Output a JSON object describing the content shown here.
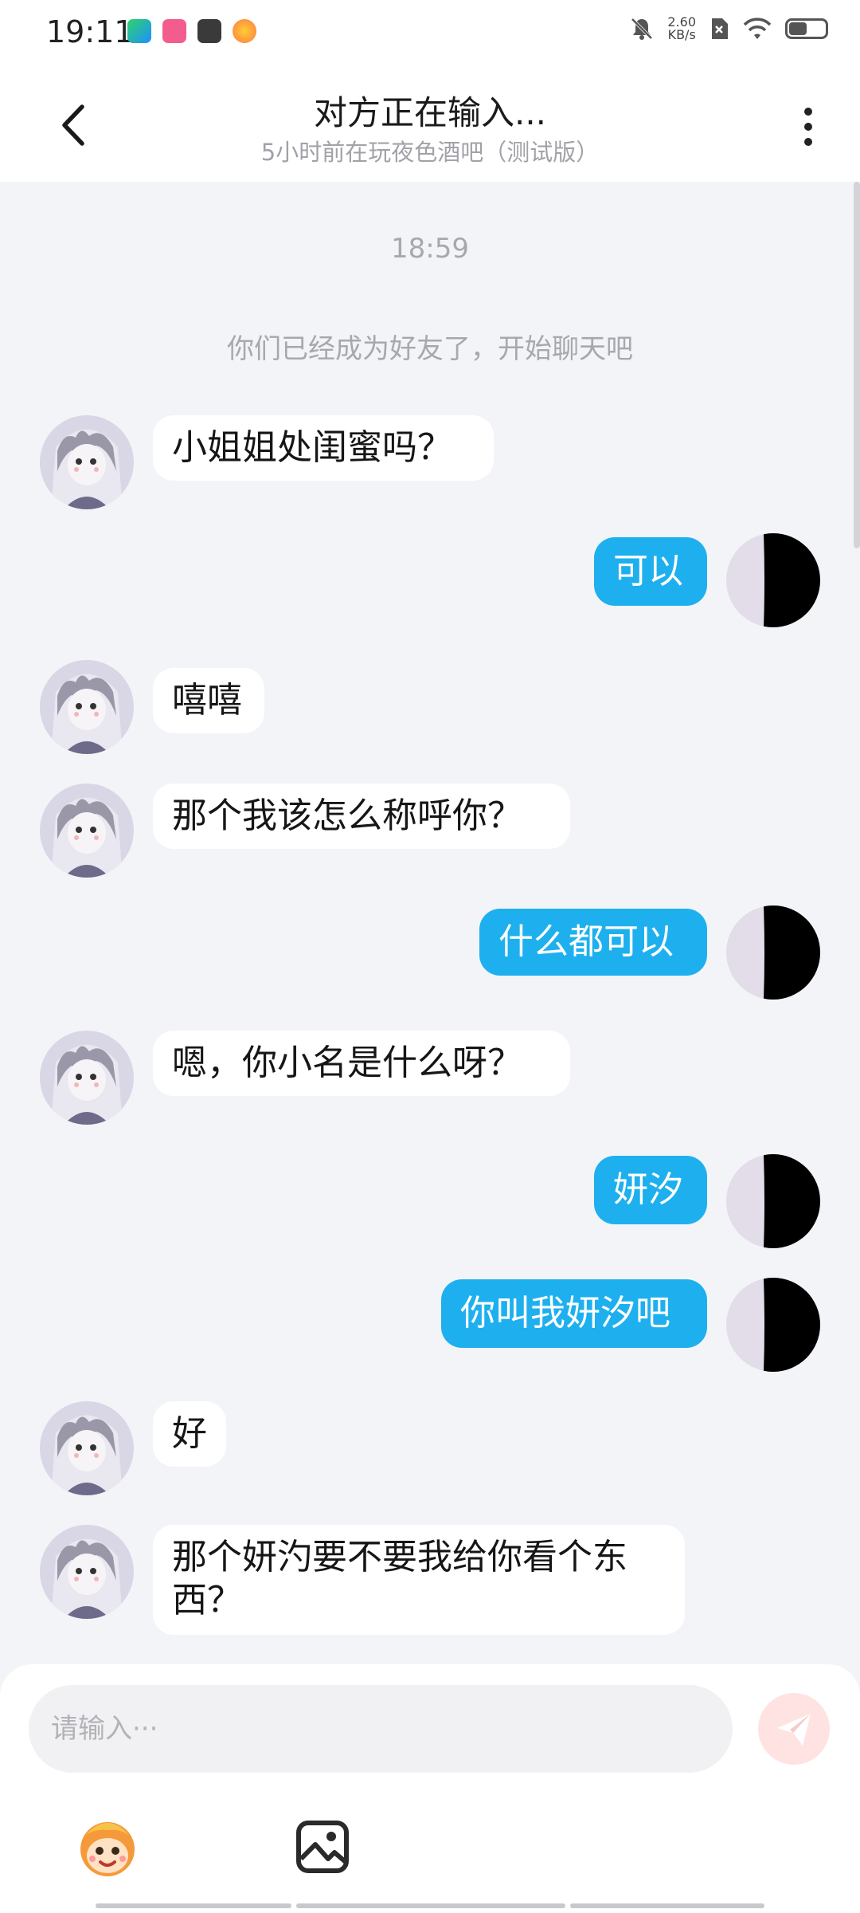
{
  "status": {
    "time": "19:11",
    "net_speed_value": "2.60",
    "net_speed_unit": "KB/s"
  },
  "header": {
    "title": "对方正在输入...",
    "subtitle": "5小时前在玩夜色酒吧（测试版）"
  },
  "chat": {
    "timestamp": "18:59",
    "system_message": "你们已经成为好友了，开始聊天吧",
    "messages": [
      {
        "from": "them",
        "text": "小姐姐处闺蜜吗？"
      },
      {
        "from": "me",
        "text": "可以"
      },
      {
        "from": "them",
        "text": "嘻嘻"
      },
      {
        "from": "them",
        "text": "那个我该怎么称呼你？"
      },
      {
        "from": "me",
        "text": "什么都可以"
      },
      {
        "from": "them",
        "text": "嗯，你小名是什么呀？"
      },
      {
        "from": "me",
        "text": "妍汐"
      },
      {
        "from": "me",
        "text": "你叫我妍汐吧"
      },
      {
        "from": "them",
        "text": "好"
      },
      {
        "from": "them",
        "text": "那个妍汋要不要我给你看个东西？"
      }
    ]
  },
  "composer": {
    "placeholder": "请输入···"
  },
  "colors": {
    "my_bubble": "#1eb0ee",
    "their_bubble": "#ffffff",
    "chat_background": "#f3f4f8",
    "send_button": "#ffe3e3"
  },
  "icons": {
    "back": "chevron-left-icon",
    "more": "more-vertical-icon",
    "send": "paper-plane-icon",
    "emoji": "mascot-sticker-icon",
    "image": "image-picker-icon"
  }
}
